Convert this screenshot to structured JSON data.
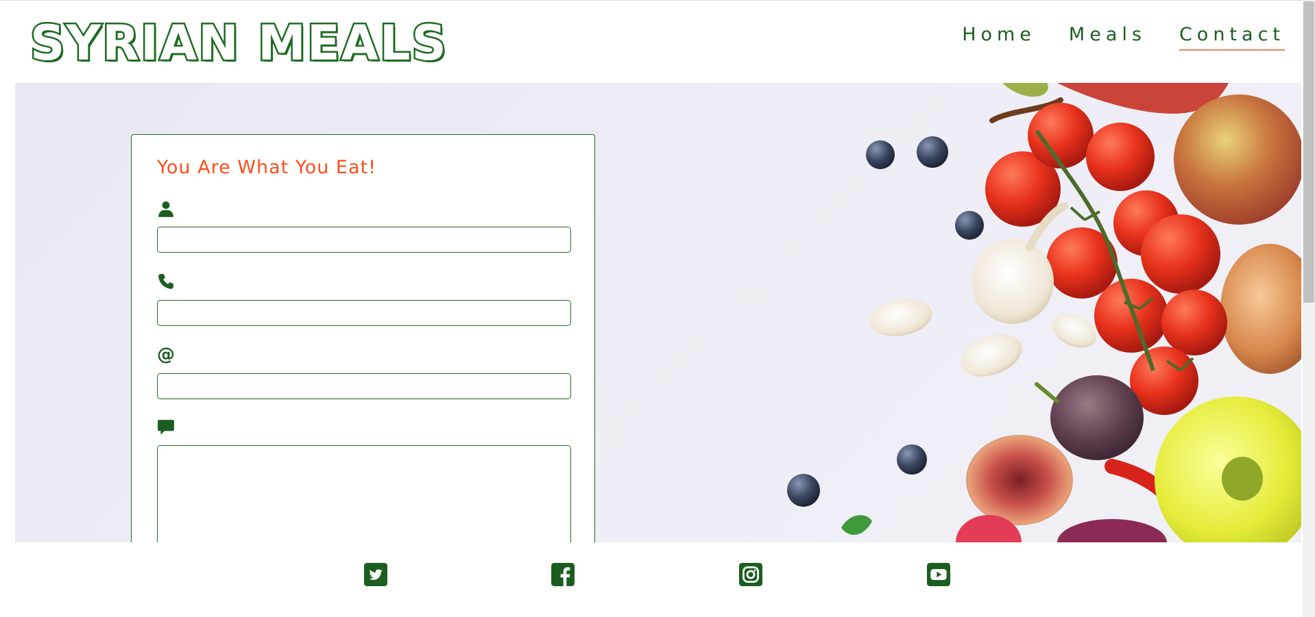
{
  "header": {
    "logo_text": "SYRIAN MEALS",
    "nav": [
      {
        "label": "Home",
        "active": false
      },
      {
        "label": "Meals",
        "active": false
      },
      {
        "label": "Contact",
        "active": true
      }
    ]
  },
  "form": {
    "title": "You Are What You Eat!",
    "fields": [
      {
        "icon": "user-icon",
        "value": "",
        "placeholder": ""
      },
      {
        "icon": "phone-icon",
        "value": "",
        "placeholder": ""
      },
      {
        "icon": "at-icon",
        "icon_text": "@",
        "value": "",
        "placeholder": ""
      },
      {
        "icon": "comment-icon",
        "value": "",
        "placeholder": ""
      }
    ]
  },
  "footer": {
    "social": [
      "twitter-icon",
      "facebook-icon",
      "instagram-icon",
      "youtube-icon"
    ]
  },
  "colors": {
    "brand_green": "#1b6b1f",
    "title_orange": "#ff4d1a",
    "nav_underline": "#f0805a"
  }
}
